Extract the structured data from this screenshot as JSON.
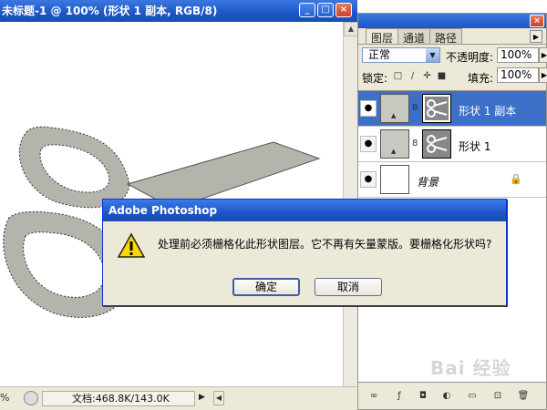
{
  "document": {
    "title": "未标题-1 @ 100% (形状 1 副本, RGB/8)",
    "window_buttons": [
      "_",
      "□",
      "×"
    ]
  },
  "status": {
    "zoom": "%",
    "doc_info": "文档:468.8K/143.0K",
    "arrow": "▶",
    "nav_left": "◀"
  },
  "layers_panel": {
    "tabs": [
      "图层",
      "通道",
      "路径"
    ],
    "blend_mode": "正常",
    "opacity_label": "不透明度:",
    "opacity_value": "100%",
    "lock_label": "锁定:",
    "fill_label": "填充:",
    "fill_value": "100%",
    "layers": [
      {
        "name": "形状 1 副本",
        "selected": true
      },
      {
        "name": "形状 1",
        "selected": false
      },
      {
        "name": "背景",
        "selected": false
      }
    ]
  },
  "dialog": {
    "title": "Adobe Photoshop",
    "message": "处理前必须栅格化此形状图层。它不再有矢量蒙版。要栅格化形状吗?",
    "ok_label": "确定",
    "cancel_label": "取消"
  },
  "watermark": "Bai 经验",
  "colors": {
    "titlebar": "#1d55c8",
    "selected_layer": "#3b6fc8",
    "dialog_bg": "#ece9d8",
    "shape_fill": "#b4b4ac"
  }
}
